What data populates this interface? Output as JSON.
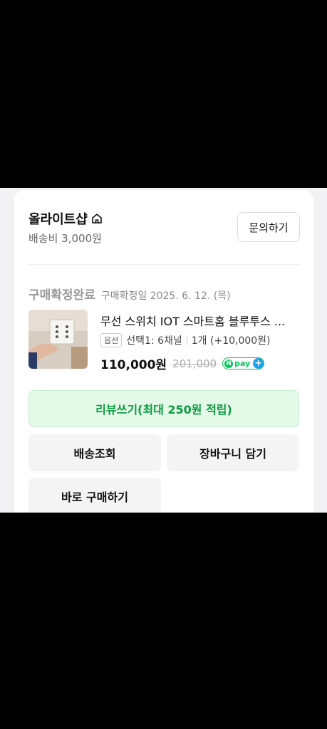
{
  "store": {
    "name": "올라이트샵",
    "icon": "home-icon",
    "shipping_fee": "배송비 3,000원",
    "inquiry_label": "문의하기"
  },
  "order": {
    "status": "구매확정완료",
    "confirm_date": "구매확정일 2025. 6. 12. (목)"
  },
  "product": {
    "title": "무선 스위치 IOT 스마트홈 블루투스 ...",
    "option_tag": "옵션",
    "option_value": "선택1: 6채널",
    "quantity": "1개 (+10,000원)",
    "price": "110,000원",
    "original_price": "201,000",
    "npay_n": "N",
    "npay_text": "pay",
    "npay_plus": "+"
  },
  "actions": {
    "review": "리뷰쓰기(최대 250원 적립)",
    "track_delivery": "배송조회",
    "add_to_cart": "장바구니 담기",
    "buy_now": "바로 구매하기"
  },
  "colors": {
    "review_bg": "#e4f9e8",
    "review_text": "#0a9b3c",
    "npay_green": "#03c75a",
    "npay_blue": "#1e9fe8"
  }
}
